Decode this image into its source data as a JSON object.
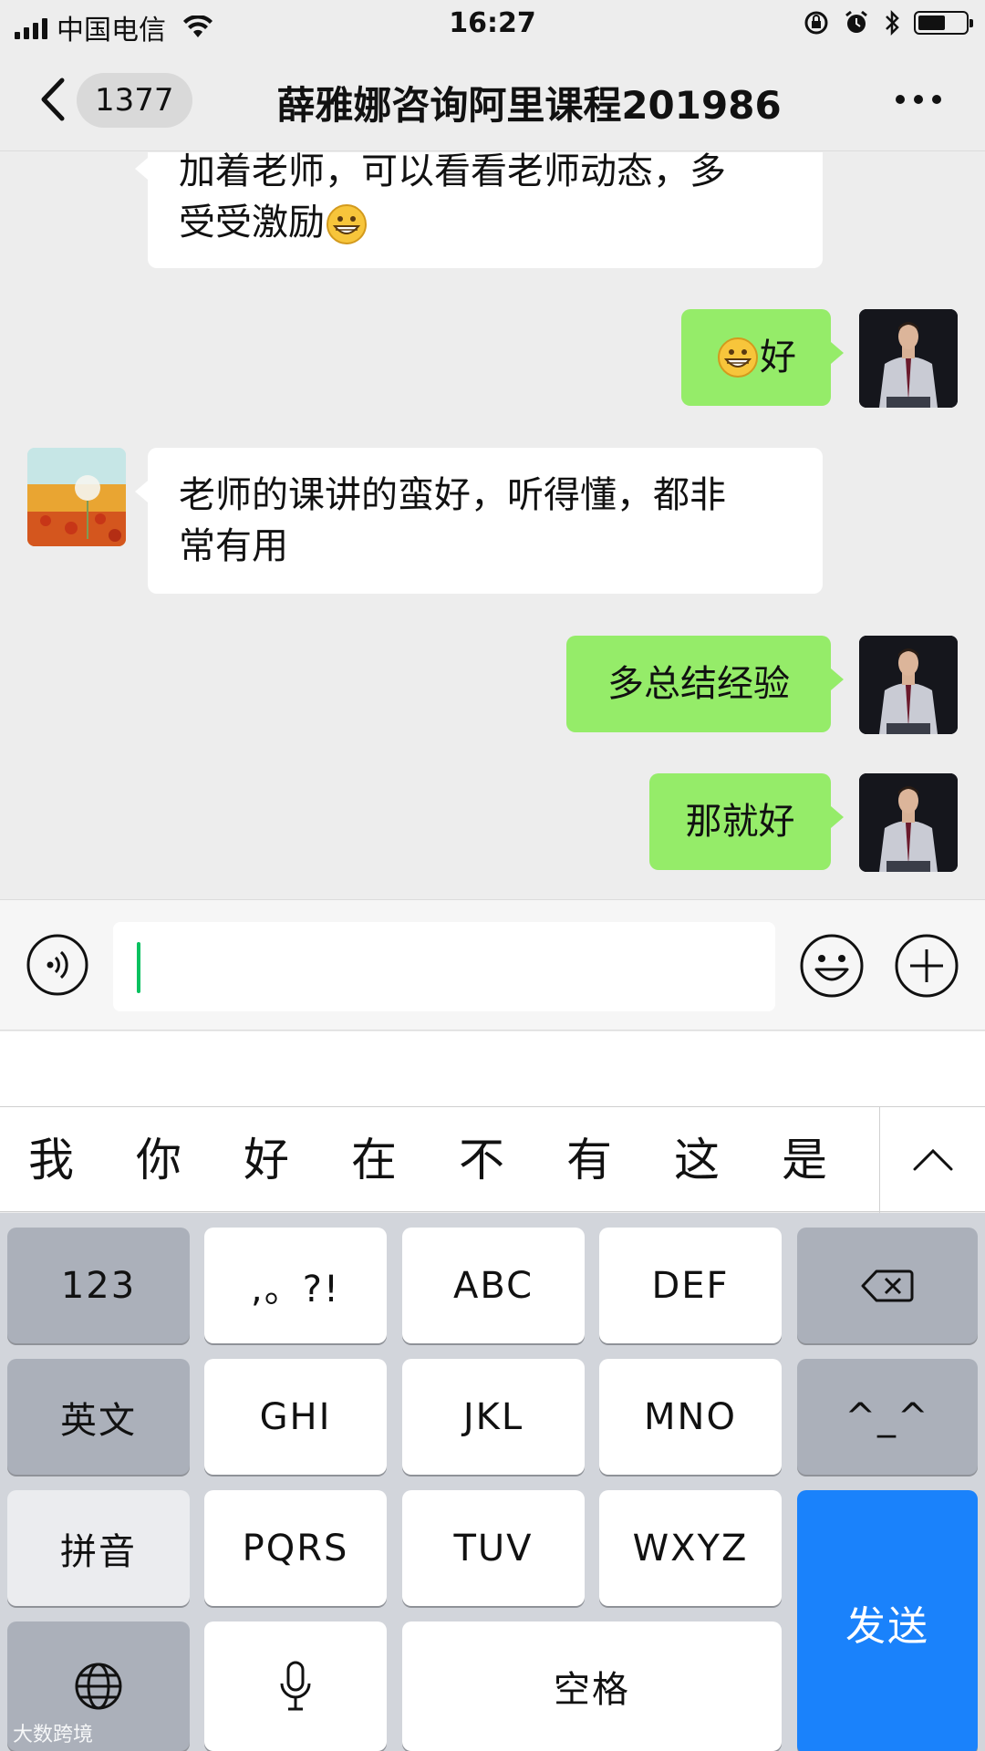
{
  "status_bar": {
    "carrier": "中国电信",
    "time": "16:27",
    "battery_level": 0.55
  },
  "nav": {
    "unread_count": "1377",
    "title": "薛雅娜咨询阿里课程201986"
  },
  "messages": [
    {
      "side": "in",
      "line1": "加着老师，可以看看老师动态，多",
      "line2": "受受激励",
      "emoji": "grinning-face-emoji"
    },
    {
      "side": "out",
      "text": "好",
      "emoji": "grinning-face-emoji"
    },
    {
      "side": "in",
      "line1": "老师的课讲的蛮好，听得懂，都非",
      "line2": "常有用"
    },
    {
      "side": "out",
      "text": "多总结经验"
    },
    {
      "side": "out",
      "text": "那就好"
    }
  ],
  "input": {
    "value": ""
  },
  "candidates": [
    "我",
    "你",
    "好",
    "在",
    "不",
    "有",
    "这",
    "是"
  ],
  "keyboard": {
    "row1": [
      "123",
      ",。?!",
      "ABC",
      "DEF"
    ],
    "row2": [
      "英文",
      "GHI",
      "JKL",
      "MNO",
      "^_^"
    ],
    "row3": [
      "拼音",
      "PQRS",
      "TUV",
      "WXYZ"
    ],
    "space": "空格",
    "send": "发送"
  },
  "watermark": "大数跨境",
  "colors": {
    "outgoing_bubble": "#95ec69",
    "send_key": "#1a82fb",
    "caret": "#07c160"
  }
}
